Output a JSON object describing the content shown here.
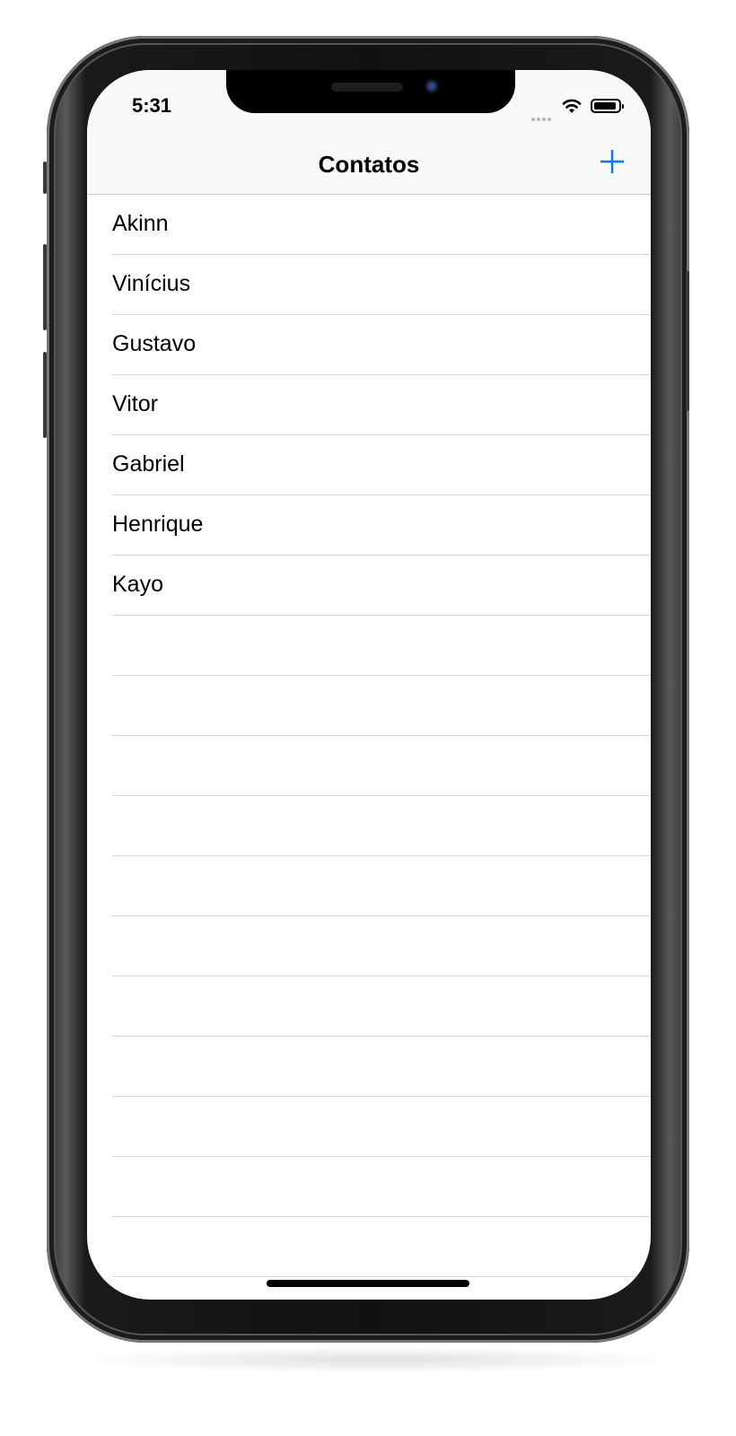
{
  "status_bar": {
    "time": "5:31"
  },
  "nav_bar": {
    "title": "Contatos",
    "add_icon": "plus-icon",
    "accent_color": "#007aff"
  },
  "contacts": [
    {
      "name": "Akinn"
    },
    {
      "name": "Vinícius"
    },
    {
      "name": "Gustavo"
    },
    {
      "name": "Vitor"
    },
    {
      "name": "Gabriel"
    },
    {
      "name": "Henrique"
    },
    {
      "name": "Kayo"
    }
  ],
  "empty_row_count": 11
}
